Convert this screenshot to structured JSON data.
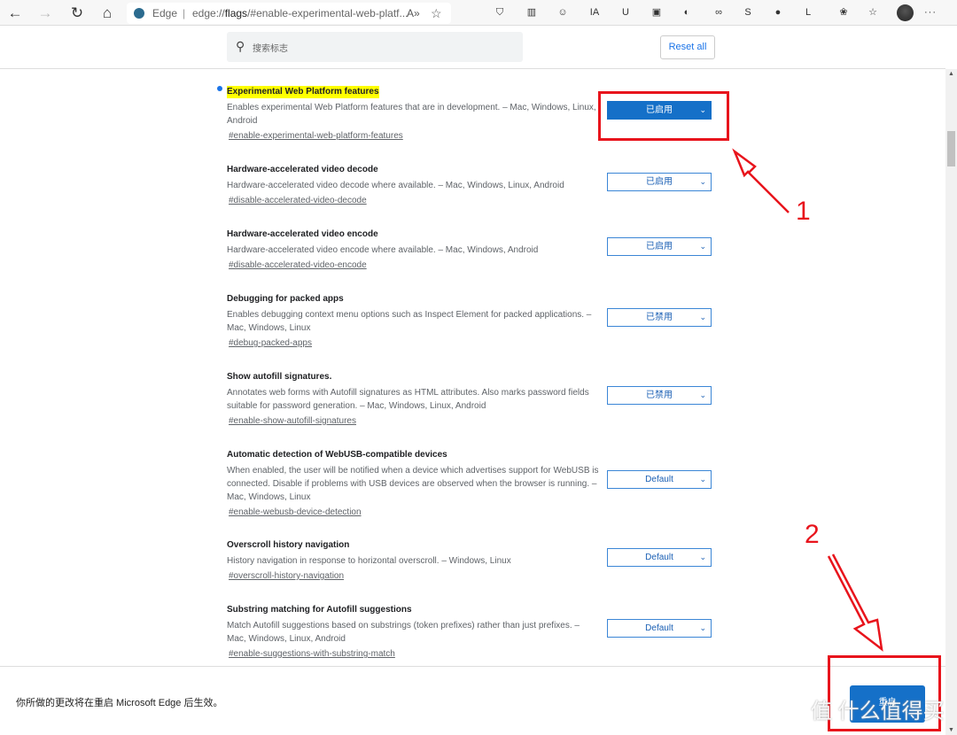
{
  "browser": {
    "edge_label": "Edge",
    "url_prefix": "edge://",
    "url_bold": "flags",
    "url_rest": "/#enable-experimental-web-platf...",
    "read_aloud": "A»",
    "favorite": "☆"
  },
  "extensions": [
    "⛉",
    "▥",
    "☺",
    "IA",
    "U",
    "▣",
    "◐",
    "∞",
    "S",
    "●",
    "L",
    "❀",
    "☆",
    "⧉"
  ],
  "menu": "···",
  "search": {
    "placeholder": "搜索标志"
  },
  "reset_label": "Reset all",
  "flags": [
    {
      "title": "Experimental Web Platform features",
      "desc": "Enables experimental Web Platform features that are in development. – Mac, Windows, Linux, Android",
      "anchor": "#enable-experimental-web-platform-features",
      "value": "已启用",
      "highlighted": true
    },
    {
      "title": "Hardware-accelerated video decode",
      "desc": "Hardware-accelerated video decode where available. – Mac, Windows, Linux, Android",
      "anchor": "#disable-accelerated-video-decode",
      "value": "已启用"
    },
    {
      "title": "Hardware-accelerated video encode",
      "desc": "Hardware-accelerated video encode where available. – Mac, Windows, Android",
      "anchor": "#disable-accelerated-video-encode",
      "value": "已启用"
    },
    {
      "title": "Debugging for packed apps",
      "desc": "Enables debugging context menu options such as Inspect Element for packed applications. – Mac, Windows, Linux",
      "anchor": "#debug-packed-apps",
      "value": "已禁用"
    },
    {
      "title": "Show autofill signatures.",
      "desc": "Annotates web forms with Autofill signatures as HTML attributes. Also marks password fields suitable for password generation. – Mac, Windows, Linux, Android",
      "anchor": "#enable-show-autofill-signatures",
      "value": "已禁用"
    },
    {
      "title": "Automatic detection of WebUSB-compatible devices",
      "desc": "When enabled, the user will be notified when a device which advertises support for WebUSB is connected. Disable if problems with USB devices are observed when the browser is running. – Mac, Windows, Linux",
      "anchor": "#enable-webusb-device-detection",
      "value": "Default"
    },
    {
      "title": "Overscroll history navigation",
      "desc": "History navigation in response to horizontal overscroll. – Windows, Linux",
      "anchor": "#overscroll-history-navigation",
      "value": "Default"
    },
    {
      "title": "Substring matching for Autofill suggestions",
      "desc": "Match Autofill suggestions based on substrings (token prefixes) rather than just prefixes. – Mac, Windows, Linux, Android",
      "anchor": "#enable-suggestions-with-substring-match",
      "value": "Default"
    }
  ],
  "bottom": {
    "message": "你所做的更改将在重启 Microsoft Edge 后生效。",
    "restart_label": "重启"
  },
  "annotations": {
    "step1": "1",
    "step2": "2",
    "color": "#e8141c"
  },
  "watermark": "值 什么值得买",
  "colors": {
    "accent": "#1570c8",
    "highlight": "#ffff00"
  }
}
